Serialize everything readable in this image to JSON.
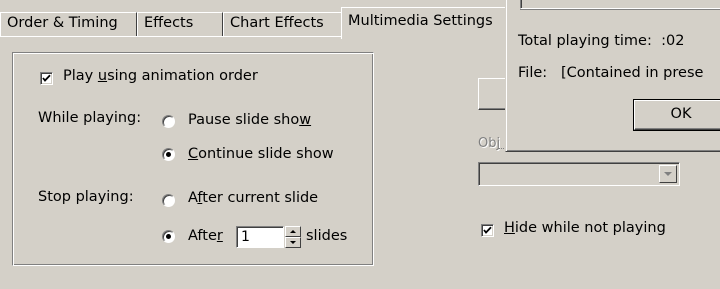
{
  "tabs": [
    {
      "label": "Order & Timing"
    },
    {
      "label": "Effects"
    },
    {
      "label": "Chart Effects"
    },
    {
      "label": "Multimedia Settings"
    }
  ],
  "play_option": {
    "label_pre": "Play ",
    "label_u": "u",
    "label_post": "sing animation order",
    "checked": true
  },
  "while_playing": {
    "label": "While playing:",
    "pause": {
      "pre": "Pause slide sho",
      "u": "w",
      "post": "",
      "selected": false
    },
    "continue": {
      "pre": "",
      "u": "C",
      "post": "ontinue slide show",
      "selected": true
    }
  },
  "stop_playing": {
    "label": "Stop playing:",
    "after_current": {
      "pre": "A",
      "u": "f",
      "post": "ter current slide",
      "selected": false
    },
    "after_n": {
      "pre": "Afte",
      "u": "r",
      "post": "",
      "selected": true
    },
    "slides_value": "1",
    "slides_label": "slides"
  },
  "object_label_partial": "Obj",
  "hide_option": {
    "pre": "",
    "u": "H",
    "post": "ide while not playing",
    "checked": true
  },
  "info_dialog": {
    "total_time_label": "Total playing time:",
    "total_time_value": ":02",
    "file_label": "File:",
    "file_value": "[Contained in prese",
    "ok_label": "OK"
  },
  "colors": {
    "face": "#d4d0c8",
    "shadow": "#808080",
    "highlight": "#ffffff"
  }
}
